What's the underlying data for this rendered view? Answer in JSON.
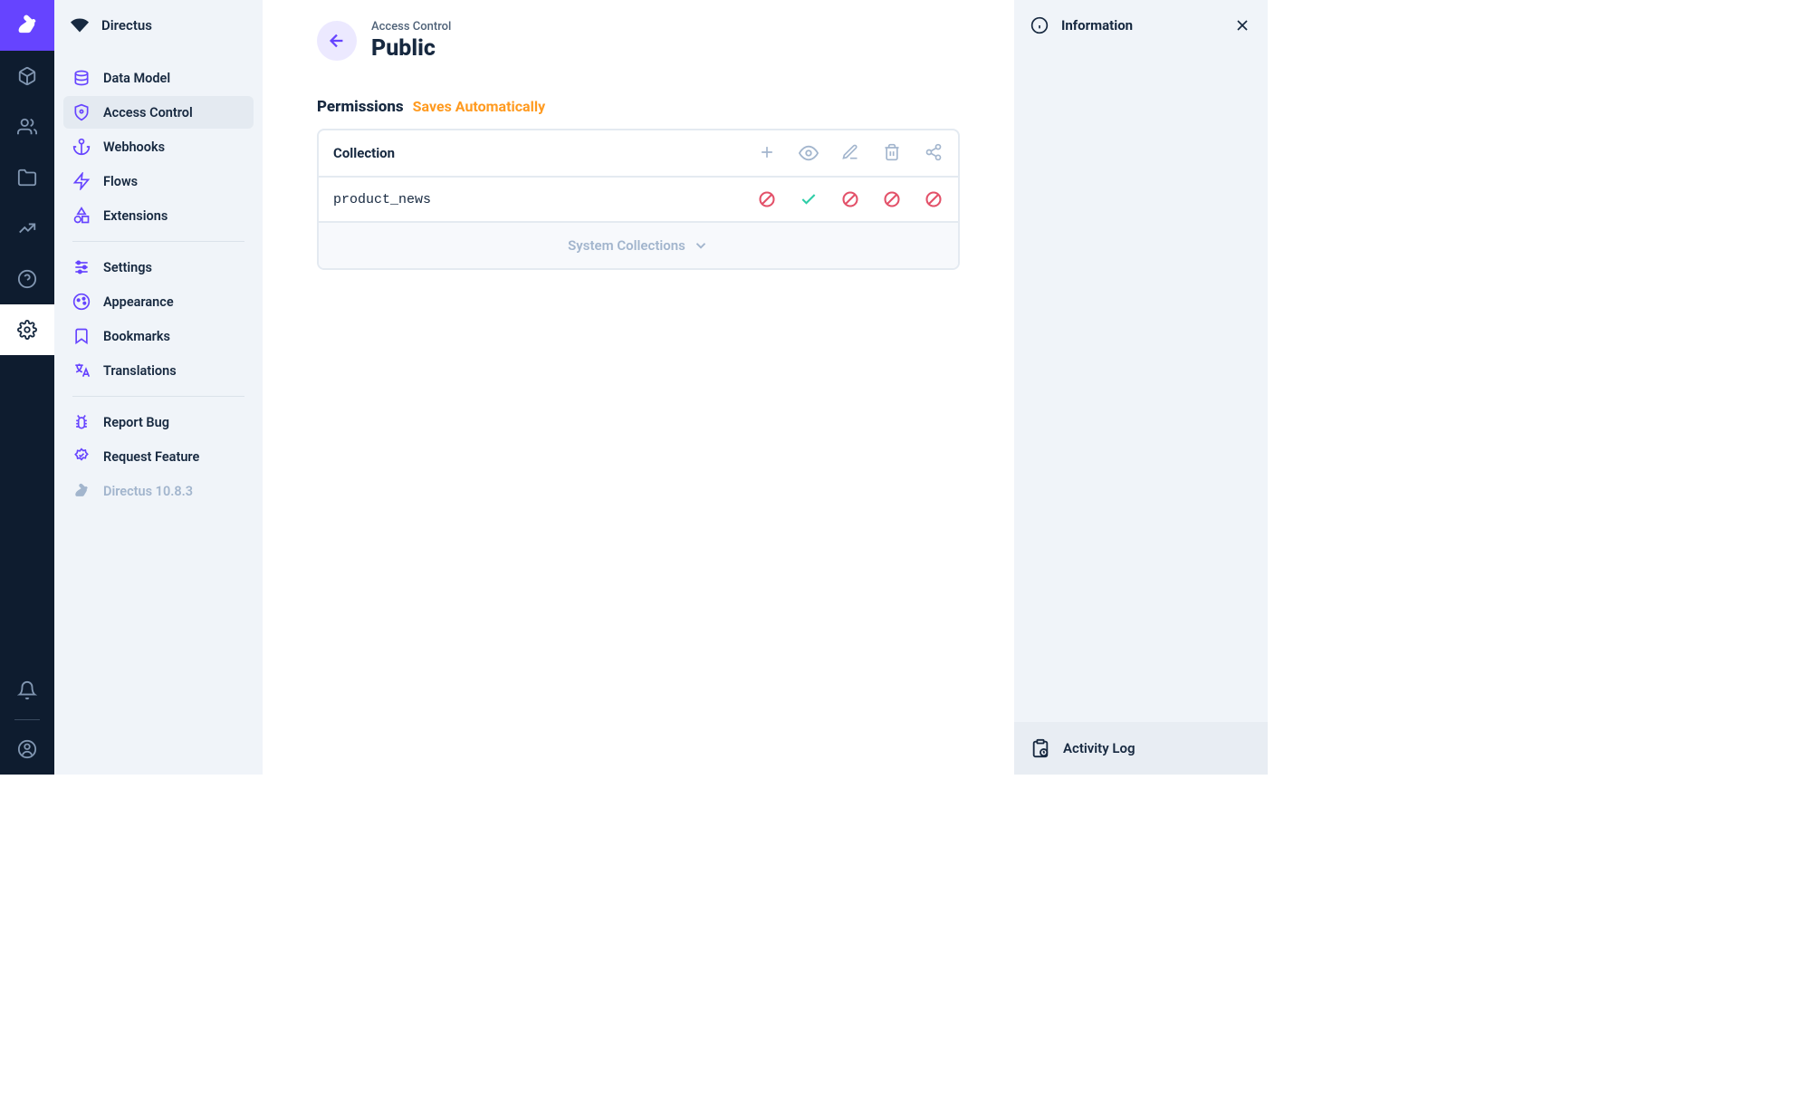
{
  "app": {
    "name": "Directus"
  },
  "nav": {
    "items": [
      {
        "label": "Data Model"
      },
      {
        "label": "Access Control"
      },
      {
        "label": "Webhooks"
      },
      {
        "label": "Flows"
      },
      {
        "label": "Extensions"
      }
    ],
    "group2": [
      {
        "label": "Settings"
      },
      {
        "label": "Appearance"
      },
      {
        "label": "Bookmarks"
      },
      {
        "label": "Translations"
      }
    ],
    "group3": [
      {
        "label": "Report Bug"
      },
      {
        "label": "Request Feature"
      },
      {
        "label": "Directus 10.8.3"
      }
    ]
  },
  "page": {
    "breadcrumb": "Access Control",
    "title": "Public"
  },
  "permissions": {
    "section_title": "Permissions",
    "section_hint": "Saves Automatically",
    "header_label": "Collection",
    "collections": [
      {
        "name": "product_news",
        "create": "denied",
        "read": "allowed",
        "update": "denied",
        "delete": "denied",
        "share": "denied"
      }
    ],
    "system_toggle": "System Collections"
  },
  "info": {
    "title": "Information",
    "activity_log": "Activity Log"
  }
}
